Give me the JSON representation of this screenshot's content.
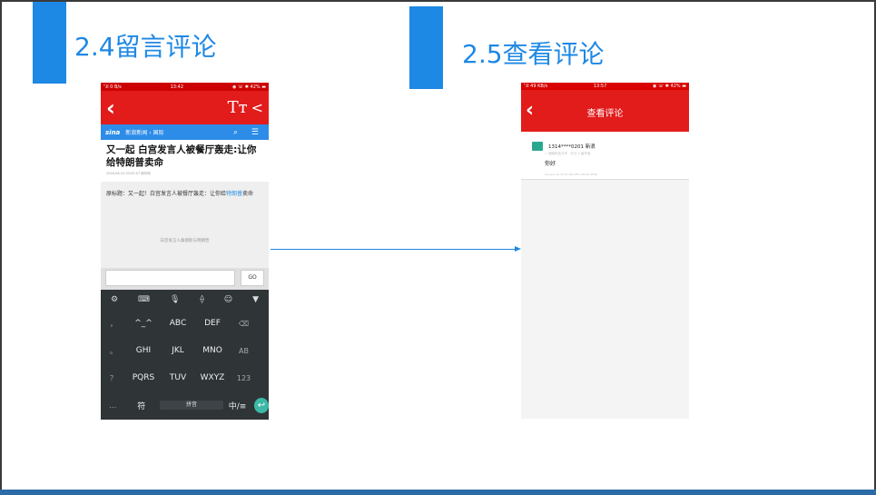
{
  "slide": {
    "left_title": "2.4留言评论",
    "right_title": "2.5查看评论"
  },
  "colors": {
    "accent_blue": "#1e88e5",
    "news_red": "#e21b1b",
    "keyboard_dark": "#2f3437",
    "enter_teal": "#3cb8a6"
  },
  "left_phone": {
    "status": {
      "left": "ᵀᵢll 0 B/s",
      "time": "13:42",
      "right": "◉ ☏ ✱ 42% ▬"
    },
    "toolbar": {
      "back_icon": "‹",
      "font_icon": "Tт",
      "share_icon": "<"
    },
    "channel": {
      "logo": "sina",
      "crumb": "新浪新闻 › 国际",
      "icons": "⌕ ☰"
    },
    "article": {
      "headline": "又一起 白宫发言人被餐厅轰走:让你给特朗普卖命",
      "meta": "2018-06-24 03:02:07  新华网",
      "body_prefix": "原标题：又一起！白宫发言人被餐厅轰走：让你给",
      "body_link": "特朗普",
      "body_suffix": "卖命",
      "image_caption": "白宫发言人桑德斯与特朗普"
    },
    "comment_input": {
      "value": "",
      "go_label": "GO"
    },
    "keyboard": {
      "tools": [
        "⚙",
        "⌨",
        "🎙",
        "⟠",
        "☺",
        "▼"
      ],
      "rows": [
        {
          "side": "，",
          "keys": [
            "^_^",
            "ABC",
            "DEF"
          ],
          "right": "⌫"
        },
        {
          "side": "。",
          "keys": [
            "GHI",
            "JKL",
            "MNO"
          ],
          "right": "AB"
        },
        {
          "side": "？",
          "keys": [
            "PQRS",
            "TUV",
            "WXYZ"
          ],
          "right": "123"
        },
        {
          "side": "…",
          "keys": [
            "符",
            "拼音",
            "中/≡"
          ],
          "right": "↩"
        }
      ]
    }
  },
  "right_phone": {
    "status": {
      "left": "ᵀᵢll 49 KB/s",
      "time": "13:57",
      "right": "◉ ☏ ✱ 42% ▬"
    },
    "header": {
      "back_icon": "‹",
      "title": "查看评论"
    },
    "comment": {
      "user": "1314****0201  新浪",
      "sub": "✓ 湖南科技大学 · 长沙 2 级学者",
      "text": "你好",
      "time": "Sun Jun 24 13:57:08 GMT+08:00 2018"
    }
  }
}
